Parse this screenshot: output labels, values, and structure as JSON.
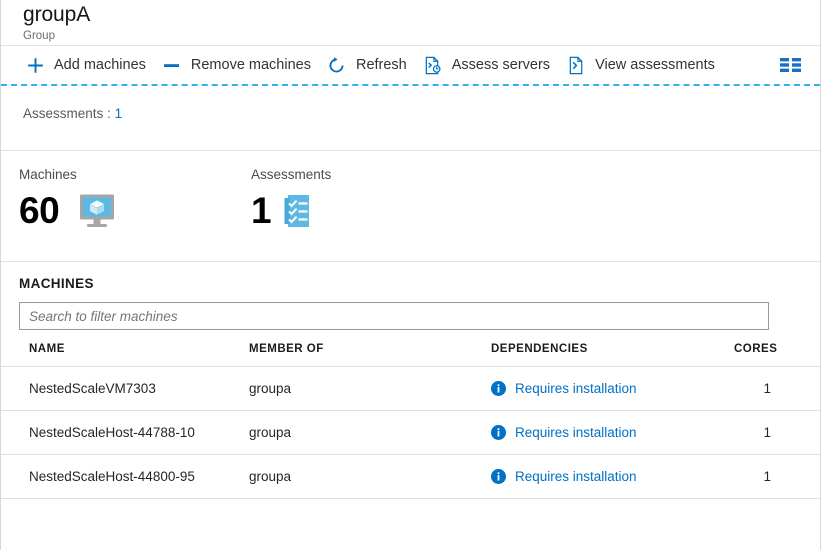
{
  "header": {
    "title": "groupA",
    "subtitle": "Group"
  },
  "toolbar": {
    "items": [
      {
        "label": "Add machines",
        "icon": "plus-icon"
      },
      {
        "label": "Remove machines",
        "icon": "minus-icon"
      },
      {
        "label": "Refresh",
        "icon": "refresh-icon"
      },
      {
        "label": "Assess servers",
        "icon": "assess-servers-icon"
      },
      {
        "label": "View assessments",
        "icon": "view-assessments-icon"
      }
    ],
    "overflow_icon": "columns-grid-icon"
  },
  "essentials": {
    "assessments_label": "Assessments",
    "separator": ":",
    "assessments_value": "1"
  },
  "stats": [
    {
      "label": "Machines",
      "value": "60",
      "icon": "monitor-box-icon"
    },
    {
      "label": "Assessments",
      "value": "1",
      "icon": "checklist-icon"
    }
  ],
  "machines_section": {
    "title": "MACHINES",
    "search_placeholder": "Search to filter machines",
    "search_value": "",
    "columns": [
      "NAME",
      "MEMBER OF",
      "DEPENDENCIES",
      "CORES"
    ],
    "rows": [
      {
        "name": "NestedScaleVM7303",
        "member_of": "groupa",
        "dependencies": "Requires installation",
        "cores": "1"
      },
      {
        "name": "NestedScaleHost-44788-10",
        "member_of": "groupa",
        "dependencies": "Requires installation",
        "cores": "1"
      },
      {
        "name": "NestedScaleHost-44800-95",
        "member_of": "groupa",
        "dependencies": "Requires installation",
        "cores": "1"
      }
    ]
  },
  "colors": {
    "accent": "#0071c5",
    "link": "#0071c5",
    "dashed_separator": "#2fb3e8",
    "icon_light_blue": "#5bb9e3"
  }
}
